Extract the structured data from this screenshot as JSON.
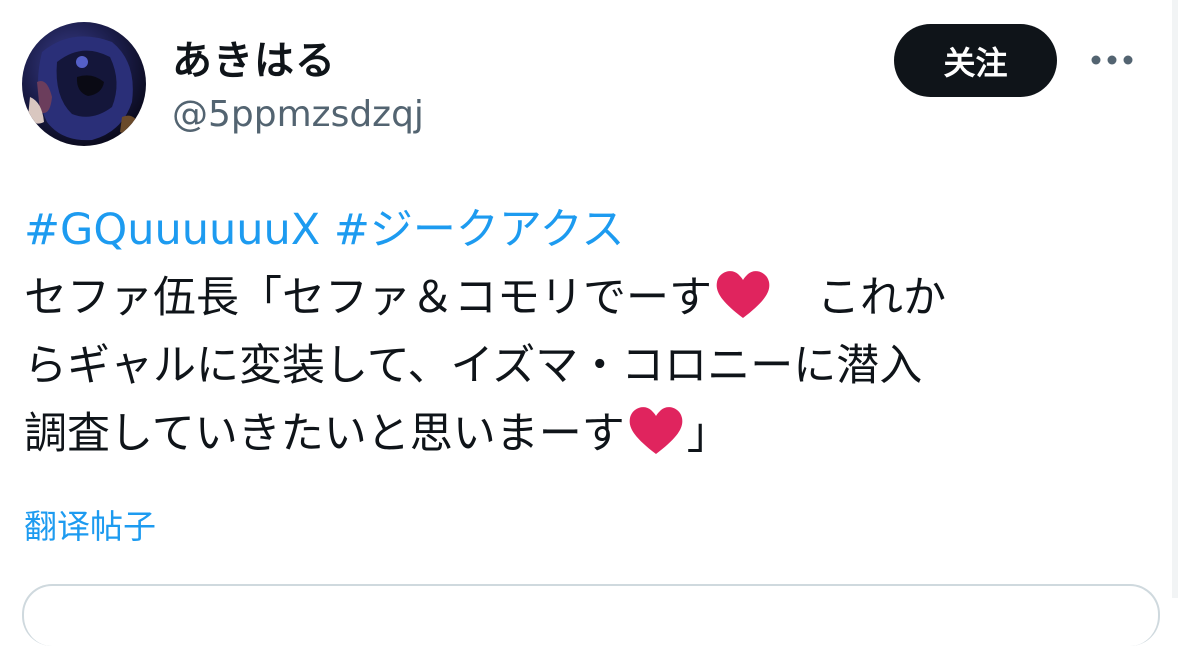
{
  "author": {
    "display_name": "あきはる",
    "handle": "@5ppmzsdzqj"
  },
  "actions": {
    "follow_label": "关注",
    "more_icon": "more-horizontal-icon"
  },
  "tweet": {
    "hashtags": [
      "#GQuuuuuuX",
      "#ジークアクス"
    ],
    "line1": "セファ伍長「セファ＆コモリでーす",
    "line1_after": "　これか",
    "line2": "らギャルに変装して、イズマ・コロニーに潜入",
    "line3": "調査していきたいと思いまーす",
    "line3_after": "」",
    "emoji": "red-heart-icon"
  },
  "translate_label": "翻译帖子",
  "colors": {
    "link": "#1d9bf0",
    "text": "#0f1419",
    "secondary": "#536471",
    "button_bg": "#0f1419",
    "heart": "#e0245e"
  }
}
